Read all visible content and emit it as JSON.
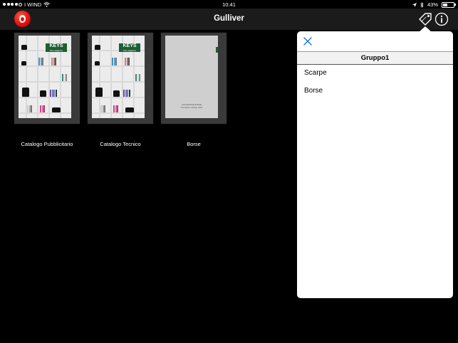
{
  "status_bar": {
    "carrier": "I WIND",
    "time": "10:41",
    "battery": "43%",
    "battery_level": 0.43
  },
  "navbar": {
    "title": "Gulliver"
  },
  "catalogs": [
    {
      "label": "Catalogo Pubblicitario",
      "cover_brand": "KEYS",
      "cover_tagline": "Fine stagione"
    },
    {
      "label": "Catalogo Tecnico",
      "cover_brand": "KEYS",
      "cover_tagline": "Fine stagione"
    },
    {
      "label": "Borse",
      "cover_line1": "COLLEZIONE BORSE",
      "cover_line2": "Primavera / Estate 2015"
    }
  ],
  "popover": {
    "header": "Gruppo1",
    "items": [
      "Scarpe",
      "Borse"
    ]
  },
  "colors": {
    "navbar": "#1b1b1b",
    "brand_red": "#e2140c",
    "catalog_green": "#1f5e34",
    "popover_bg": "#ffffff"
  },
  "icons": [
    "vodafone-logo",
    "wifi-icon",
    "location-icon",
    "bluetooth-icon",
    "tag-icon",
    "info-icon",
    "close-icon"
  ]
}
